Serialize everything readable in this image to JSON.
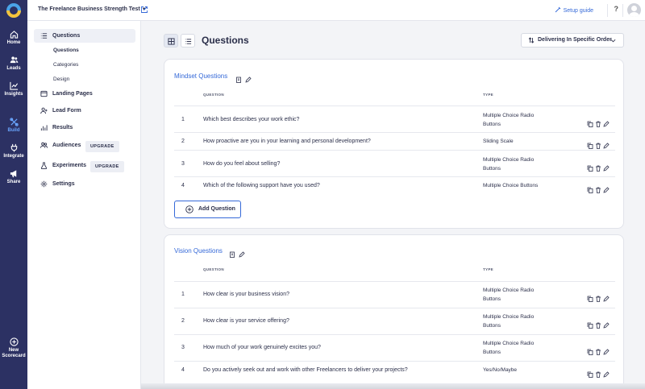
{
  "rail": {
    "items": [
      {
        "label": "Home",
        "icon": "home-icon"
      },
      {
        "label": "Leads",
        "icon": "users-icon"
      },
      {
        "label": "Insights",
        "icon": "chart-icon"
      },
      {
        "label": "Build",
        "icon": "build-icon"
      },
      {
        "label": "Integrate",
        "icon": "plug-icon"
      },
      {
        "label": "Share",
        "icon": "megaphone-icon"
      }
    ],
    "new_scorecard": [
      "New",
      "Scorecard"
    ]
  },
  "header": {
    "title": "The Freelance Business Strength Test",
    "setup_guide": "Setup guide",
    "help": "?"
  },
  "subnav": {
    "items": {
      "questions": "Questions",
      "landing": "Landing Pages",
      "lead_form": "Lead Form",
      "results": "Results",
      "audiences": "Audiences",
      "experiments": "Experiments",
      "settings": "Settings"
    },
    "sub_items": [
      "Questions",
      "Categories",
      "Design"
    ],
    "upgrade_label": "UPGRADE"
  },
  "main": {
    "title": "Questions",
    "order_label": "Delivering In Specific Order",
    "col_question": "QUESTION",
    "col_type": "TYPE",
    "add_question_label": "Add Question"
  },
  "sections": [
    {
      "title": "Mindset Questions",
      "rows": [
        {
          "num": "1",
          "question": "Which best describes your work ethic?",
          "type": [
            "Multiple Choice Radio",
            "Buttons"
          ]
        },
        {
          "num": "2",
          "question": "How proactive are you in your learning and personal development?",
          "type": [
            "Sliding Scale"
          ]
        },
        {
          "num": "3",
          "question": "How do you feel about selling?",
          "type": [
            "Multiple Choice Radio",
            "Buttons"
          ]
        },
        {
          "num": "4",
          "question": "Which of the following support have you used?",
          "type": [
            "Multiple Choice Buttons"
          ]
        }
      ]
    },
    {
      "title": "Vision Questions",
      "rows": [
        {
          "num": "1",
          "question": "How clear is your business vision?",
          "type": [
            "Multiple Choice Radio",
            "Buttons"
          ]
        },
        {
          "num": "2",
          "question": "How clear is your service offering?",
          "type": [
            "Multiple Choice Radio",
            "Buttons"
          ]
        },
        {
          "num": "3",
          "question": "How much of your work genuinely excites you?",
          "type": [
            "Multiple Choice Radio",
            "Buttons"
          ]
        },
        {
          "num": "4",
          "question": "Do you actively seek out and work with other Freelancers to deliver your projects?",
          "type": [
            "Yes/No/Maybe"
          ]
        }
      ]
    }
  ],
  "colors": {
    "rail": "#2c3163",
    "accent": "#3569d8",
    "active_rail": "#6aa6ff"
  }
}
